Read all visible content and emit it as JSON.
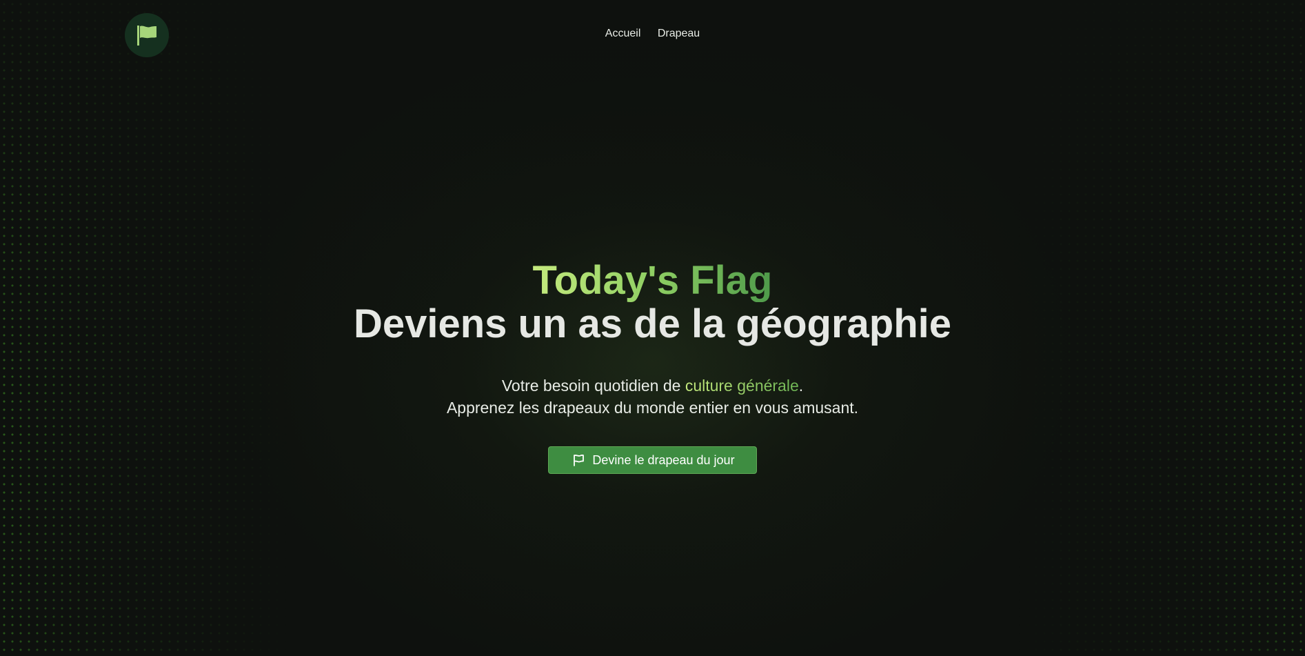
{
  "nav": {
    "logo_icon": "flag-icon",
    "links": [
      {
        "label": "Accueil"
      },
      {
        "label": "Drapeau"
      }
    ]
  },
  "hero": {
    "brand": "Today's Flag",
    "headline": "Deviens un as de la géographie",
    "line1_before": "Votre besoin quotidien de ",
    "line1_accent": "culture générale",
    "line1_after": ".",
    "line2": "Apprenez les drapeaux du monde entier en vous amusant.",
    "cta_label": "Devine le drapeau du jour",
    "cta_icon": "flag-outline-icon"
  },
  "colors": {
    "background": "#0e110e",
    "accent_light": "#c5ea7e",
    "accent_dark": "#4e9a4a",
    "button": "#3e8d41",
    "logo_bg": "#15301f"
  }
}
